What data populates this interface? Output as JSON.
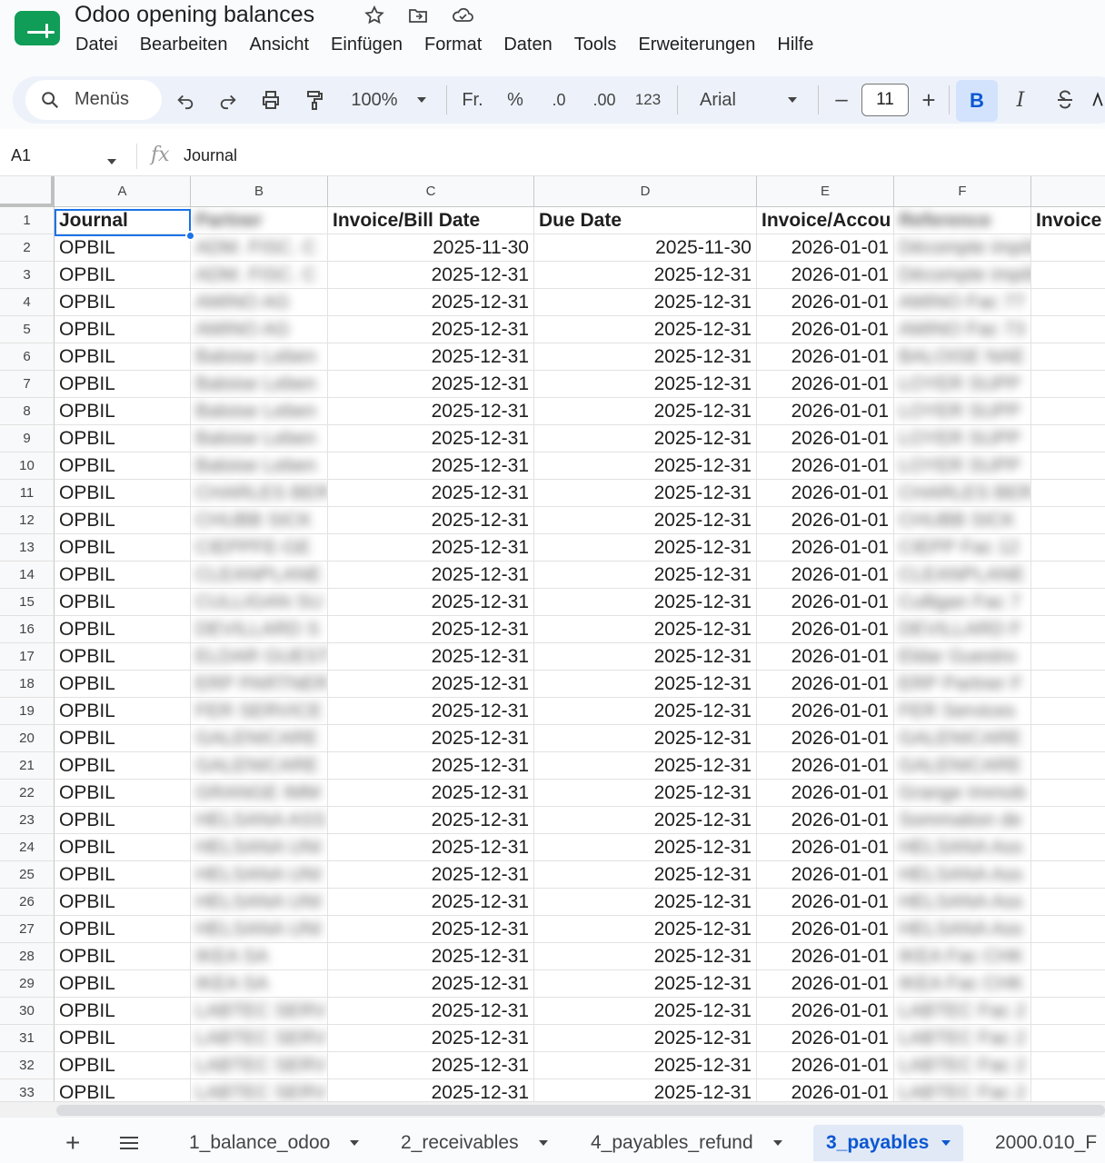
{
  "doc": {
    "title": "Odoo opening balances",
    "icons": [
      "star-icon",
      "move-to-folder-icon",
      "cloud-saved-icon"
    ]
  },
  "menu": [
    "Datei",
    "Bearbeiten",
    "Ansicht",
    "Einfügen",
    "Format",
    "Daten",
    "Tools",
    "Erweiterungen",
    "Hilfe"
  ],
  "toolbar": {
    "search_label": "Menüs",
    "zoom": "100%",
    "currency": "Fr.",
    "percent": "%",
    "dec_decrease": ".0",
    "dec_increase": ".00",
    "number_format": "123",
    "font": "Arial",
    "font_size": "11",
    "minus": "–",
    "plus": "+",
    "bold": "B",
    "italic": "I"
  },
  "formula_bar": {
    "cell_ref": "A1",
    "fx": "fx",
    "value": "Journal"
  },
  "columns": [
    "A",
    "B",
    "C",
    "D",
    "E",
    "F"
  ],
  "header_row": [
    "Journal",
    "Partner",
    "Invoice/Bill Date",
    "Due Date",
    "Invoice/Accou",
    "Reference",
    "Invoice"
  ],
  "rows": [
    [
      "OPBIL",
      "ADM. FISC. C",
      "2025-11-30",
      "2025-11-30",
      "2026-01-01",
      "Décompte impôt"
    ],
    [
      "OPBIL",
      "ADM. FISC. C",
      "2025-12-31",
      "2025-12-31",
      "2026-01-01",
      "Décompte impôt"
    ],
    [
      "OPBIL",
      "AMINO AG",
      "2025-12-31",
      "2025-12-31",
      "2026-01-01",
      "AMINO Fac 77"
    ],
    [
      "OPBIL",
      "AMINO AG",
      "2025-12-31",
      "2025-12-31",
      "2026-01-01",
      "AMINO Fac 73"
    ],
    [
      "OPBIL",
      "Baloise Leben",
      "2025-12-31",
      "2025-12-31",
      "2026-01-01",
      "BALOISE NAE"
    ],
    [
      "OPBIL",
      "Baloise Leben",
      "2025-12-31",
      "2025-12-31",
      "2026-01-01",
      "LOYER SUPP"
    ],
    [
      "OPBIL",
      "Baloise Leben",
      "2025-12-31",
      "2025-12-31",
      "2026-01-01",
      "LOYER SUPP"
    ],
    [
      "OPBIL",
      "Baloise Leben",
      "2025-12-31",
      "2025-12-31",
      "2026-01-01",
      "LOYER SUPP"
    ],
    [
      "OPBIL",
      "Baloise Leben",
      "2025-12-31",
      "2025-12-31",
      "2026-01-01",
      "LOYER SUPP"
    ],
    [
      "OPBIL",
      "CHARLES BER",
      "2025-12-31",
      "2025-12-31",
      "2026-01-01",
      "CHARLES BER"
    ],
    [
      "OPBIL",
      "CHUBB SICK",
      "2025-12-31",
      "2025-12-31",
      "2026-01-01",
      "CHUBB SICK"
    ],
    [
      "OPBIL",
      "CIEPPFE-GE",
      "2025-12-31",
      "2025-12-31",
      "2026-01-01",
      "CIEPP Fac 12"
    ],
    [
      "OPBIL",
      "CLEANPLANE",
      "2025-12-31",
      "2025-12-31",
      "2026-01-01",
      "CLEANPLANE"
    ],
    [
      "OPBIL",
      "CULLIGAN SU",
      "2025-12-31",
      "2025-12-31",
      "2026-01-01",
      "Culligan Fac 7"
    ],
    [
      "OPBIL",
      "DEVILLARD S",
      "2025-12-31",
      "2025-12-31",
      "2026-01-01",
      "DEVILLARD F"
    ],
    [
      "OPBIL",
      "ELDAR GUEST",
      "2025-12-31",
      "2025-12-31",
      "2026-01-01",
      "Eldar Guestro"
    ],
    [
      "OPBIL",
      "ERP PARTNER",
      "2025-12-31",
      "2025-12-31",
      "2026-01-01",
      "ERP Partner F"
    ],
    [
      "OPBIL",
      "FER SERVICE",
      "2025-12-31",
      "2025-12-31",
      "2026-01-01",
      "FER Services"
    ],
    [
      "OPBIL",
      "GALENICARE",
      "2025-12-31",
      "2025-12-31",
      "2026-01-01",
      "GALENICARE"
    ],
    [
      "OPBIL",
      "GALENICARE",
      "2025-12-31",
      "2025-12-31",
      "2026-01-01",
      "GALENICARE"
    ],
    [
      "OPBIL",
      "GRANGE IMM",
      "2025-12-31",
      "2025-12-31",
      "2026-01-01",
      "Grange Immob"
    ],
    [
      "OPBIL",
      "HELSANA ASS",
      "2025-12-31",
      "2025-12-31",
      "2026-01-01",
      "Sommation de"
    ],
    [
      "OPBIL",
      "HELSANA UNI",
      "2025-12-31",
      "2025-12-31",
      "2026-01-01",
      "HELSANA Ass"
    ],
    [
      "OPBIL",
      "HELSANA UNI",
      "2025-12-31",
      "2025-12-31",
      "2026-01-01",
      "HELSANA Ass"
    ],
    [
      "OPBIL",
      "HELSANA UNI",
      "2025-12-31",
      "2025-12-31",
      "2026-01-01",
      "HELSANA Ass"
    ],
    [
      "OPBIL",
      "HELSANA UNI",
      "2025-12-31",
      "2025-12-31",
      "2026-01-01",
      "HELSANA Ass"
    ],
    [
      "OPBIL",
      "IKEA SA",
      "2025-12-31",
      "2025-12-31",
      "2026-01-01",
      "IKEA Fac CHK"
    ],
    [
      "OPBIL",
      "IKEA SA",
      "2025-12-31",
      "2025-12-31",
      "2026-01-01",
      "IKEA Fac CHK"
    ],
    [
      "OPBIL",
      "LABTEC SERV",
      "2025-12-31",
      "2025-12-31",
      "2026-01-01",
      "LABTEC Fac 2"
    ],
    [
      "OPBIL",
      "LABTEC SERV",
      "2025-12-31",
      "2025-12-31",
      "2026-01-01",
      "LABTEC Fac 2"
    ],
    [
      "OPBIL",
      "LABTEC SERV",
      "2025-12-31",
      "2025-12-31",
      "2026-01-01",
      "LABTEC Fac 2"
    ],
    [
      "OPBIL",
      "LABTEC SERV",
      "2025-12-31",
      "2025-12-31",
      "2026-01-01",
      "LABTEC Fac 2"
    ]
  ],
  "sheet_tabs": [
    "1_balance_odoo",
    "2_receivables",
    "4_payables_refund",
    "3_payables",
    "2000.010_F"
  ],
  "active_tab_index": 3,
  "colors": {
    "accent": "#1a73e8",
    "sheets_green": "#0f9d58",
    "active_tab_bg": "#e1e9f7"
  }
}
